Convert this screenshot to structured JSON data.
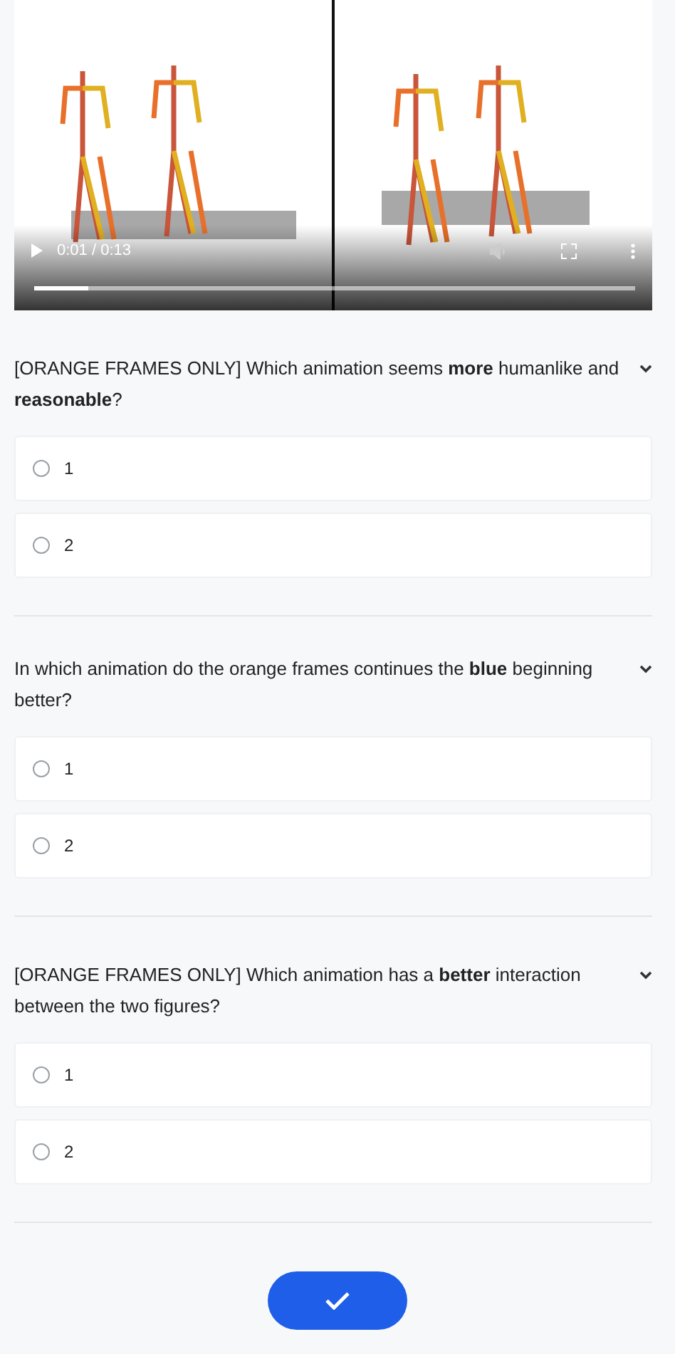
{
  "video": {
    "kind": "picture",
    "time": "0:01 / 0:13",
    "progress": {
      "level": 0.09
    }
  },
  "questions": [
    {
      "text": "[ORANGE FRAMES ONLY] Which animation seems **more** humanlike and **reasonable**?",
      "expanded": true,
      "options": [
        {
          "label": "1",
          "selected": false
        },
        {
          "label": "2",
          "selected": false
        }
      ]
    },
    {
      "text": "In which animation do the orange frames continues the **blue** beginning better?",
      "expanded": true,
      "options": [
        {
          "label": "1",
          "selected": false
        },
        {
          "label": "2",
          "selected": false
        }
      ]
    },
    {
      "text": "[ORANGE FRAMES ONLY] Which animation has a **better** interaction between the two figures?",
      "expanded": true,
      "options": [
        {
          "label": "1",
          "selected": false
        },
        {
          "label": "2",
          "selected": false
        }
      ]
    }
  ],
  "submit": {
    "kind": "check"
  }
}
